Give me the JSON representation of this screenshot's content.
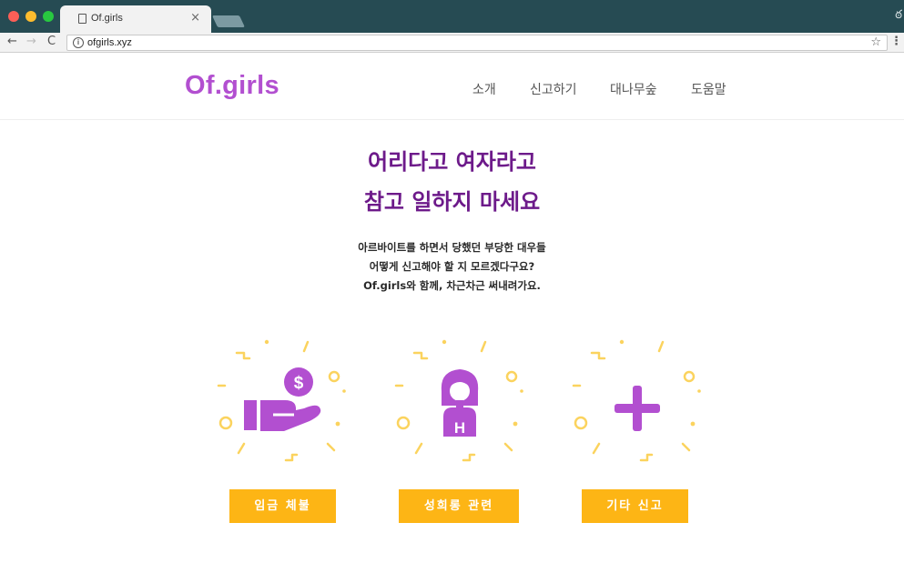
{
  "browser": {
    "tab_title": "Of.girls",
    "tab_close": "×",
    "url": "ofgirls.xyz",
    "back": "←",
    "forward": "→",
    "reload": "C",
    "info": "i",
    "bookmark": "☆",
    "menu": "⋮",
    "incognito": "ఠ"
  },
  "site": {
    "logo": "Of.girls",
    "nav": [
      "소개",
      "신고하기",
      "대나무숲",
      "도움말"
    ]
  },
  "hero": {
    "title_line1": "어리다고 여자라고",
    "title_line2": "참고 일하지 마세요",
    "desc_line1": "아르바이트를 하면서 당했던 부당한 대우들",
    "desc_line2": "어떻게 신고해야 할 지 모르겠다구요?",
    "desc_line3": "Of.girls와 함께, 차근차근 써내려가요."
  },
  "categories": [
    {
      "label": "임금 체불",
      "icon": "hand-holding-money-icon"
    },
    {
      "label": "성희롱 관련",
      "icon": "girl-icon"
    },
    {
      "label": "기타 신고",
      "icon": "plus-icon"
    }
  ],
  "colors": {
    "brand_purple": "#b24fd0",
    "title_purple": "#6d1a8a",
    "button_yellow": "#fdb515",
    "decor_yellow": "#fbd35e"
  }
}
